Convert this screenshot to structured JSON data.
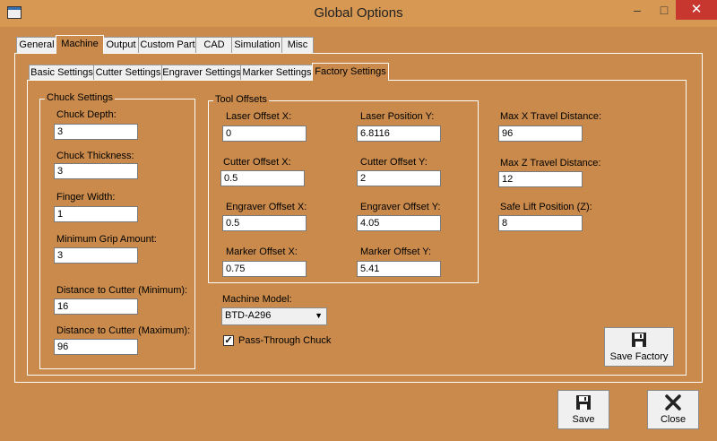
{
  "window": {
    "title": "Global Options",
    "minimize_icon": "minimize-icon",
    "maximize_icon": "maximize-icon",
    "close_icon": "close-x-icon"
  },
  "main_tabs": [
    "General",
    "Machine",
    "Output",
    "Custom Part",
    "CAD",
    "Simulation",
    "Misc"
  ],
  "main_tab_selected": "Machine",
  "sub_tabs": [
    "Basic Settings",
    "Cutter Settings",
    "Engraver Settings",
    "Marker Settings",
    "Factory Settings"
  ],
  "sub_tab_selected": "Factory Settings",
  "chuck": {
    "legend": "Chuck Settings",
    "depth_label": "Chuck Depth:",
    "depth": "3",
    "thickness_label": "Chuck Thickness:",
    "thickness": "3",
    "finger_label": "Finger Width:",
    "finger": "1",
    "grip_label": "Minimum Grip Amount:",
    "grip": "3",
    "dist_min_label": "Distance to Cutter (Minimum):",
    "dist_min": "16",
    "dist_max_label": "Distance to Cutter (Maximum):",
    "dist_max": "96"
  },
  "tool": {
    "legend": "Tool Offsets",
    "laser_x_label": "Laser Offset X:",
    "laser_x": "0",
    "laser_pos_y_label": "Laser Position Y:",
    "laser_pos_y": "6.8116",
    "cutter_x_label": "Cutter Offset X:",
    "cutter_x": "0.5",
    "cutter_y_label": "Cutter Offset Y:",
    "cutter_y": "2",
    "engraver_x_label": "Engraver Offset X:",
    "engraver_x": "0.5",
    "engraver_y_label": "Engraver Offset Y:",
    "engraver_y": "4.05",
    "marker_x_label": "Marker Offset X:",
    "marker_x": "0.75",
    "marker_y_label": "Marker Offset Y:",
    "marker_y": "5.41"
  },
  "limits": {
    "max_x_label": "Max X Travel Distance:",
    "max_x": "96",
    "max_z_label": "Max Z Travel Distance:",
    "max_z": "12",
    "safe_lift_label": "Safe Lift Position (Z):",
    "safe_lift": "8"
  },
  "machine": {
    "model_label": "Machine Model:",
    "model": "BTD-A296",
    "pass_through_label": "Pass-Through Chuck",
    "pass_through_checked": true
  },
  "buttons": {
    "save_factory": "Save Factory",
    "save": "Save",
    "close": "Close"
  },
  "icons": {
    "save": "floppy-disk-icon",
    "close": "close-x-icon"
  }
}
